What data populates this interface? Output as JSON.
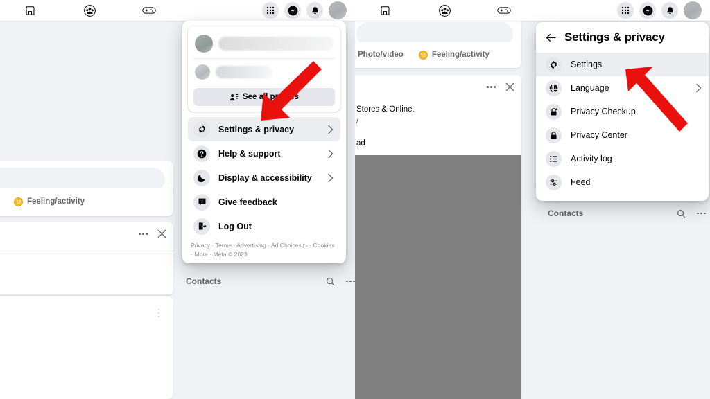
{
  "nav": {
    "items_left": [
      {
        "name": "marketplace",
        "icon": "storefront-icon"
      },
      {
        "name": "groups",
        "icon": "groups-icon"
      },
      {
        "name": "gaming",
        "icon": "gamepad-icon"
      }
    ],
    "items_right": [
      {
        "name": "menu",
        "icon": "grid-menu-icon"
      },
      {
        "name": "messenger",
        "icon": "messenger-icon"
      },
      {
        "name": "notifications",
        "icon": "bell-icon"
      },
      {
        "name": "account",
        "icon": "avatar-icon"
      }
    ]
  },
  "composer": {
    "photo_video": "Photo/video",
    "feeling_activity": "Feeling/activity"
  },
  "post": {
    "text": "Stores & Online.",
    "link": "/",
    "tail": "ad"
  },
  "contacts": {
    "label": "Contacts",
    "search_icon": "search-icon",
    "more_icon": "more-horizontal-icon"
  },
  "dropdown": {
    "see_all_profiles": "See all profiles",
    "items": [
      {
        "label": "Settings & privacy",
        "icon": "gear-icon",
        "chevron": true,
        "active": true
      },
      {
        "label": "Help & support",
        "icon": "question-circle-icon",
        "chevron": true,
        "active": false
      },
      {
        "label": "Display & accessibility",
        "icon": "moon-icon",
        "chevron": true,
        "active": false
      },
      {
        "label": "Give feedback",
        "icon": "feedback-icon",
        "chevron": false,
        "active": false
      },
      {
        "label": "Log Out",
        "icon": "logout-icon",
        "chevron": false,
        "active": false
      }
    ],
    "footer": "Privacy · Terms · Advertising · Ad Choices ▷ · Cookies · More · Meta © 2023"
  },
  "settings_panel": {
    "back_icon": "back-arrow-icon",
    "title": "Settings & privacy",
    "items": [
      {
        "label": "Settings",
        "icon": "gear-icon",
        "chevron": false,
        "active": true
      },
      {
        "label": "Language",
        "icon": "globe-icon",
        "chevron": true,
        "active": false
      },
      {
        "label": "Privacy Checkup",
        "icon": "lock-check-icon",
        "chevron": false,
        "active": false
      },
      {
        "label": "Privacy Center",
        "icon": "lock-icon",
        "chevron": false,
        "active": false
      },
      {
        "label": "Activity log",
        "icon": "list-icon",
        "chevron": false,
        "active": false
      },
      {
        "label": "Feed",
        "icon": "sliders-icon",
        "chevron": false,
        "active": false
      }
    ]
  },
  "annotations": {
    "arrow_color": "#e8110e",
    "left_arrow_target": "Settings & privacy",
    "right_arrow_target": "Settings"
  },
  "colors": {
    "page_bg": "#f0f2f5",
    "card_bg": "#ffffff",
    "hover_bg": "#ebedf0",
    "icon_bg": "#e4e6eb",
    "text_primary": "#050505",
    "text_secondary": "#65676b",
    "link": "#385898",
    "image_placeholder": "#808080",
    "accent_red": "#e8110e"
  }
}
